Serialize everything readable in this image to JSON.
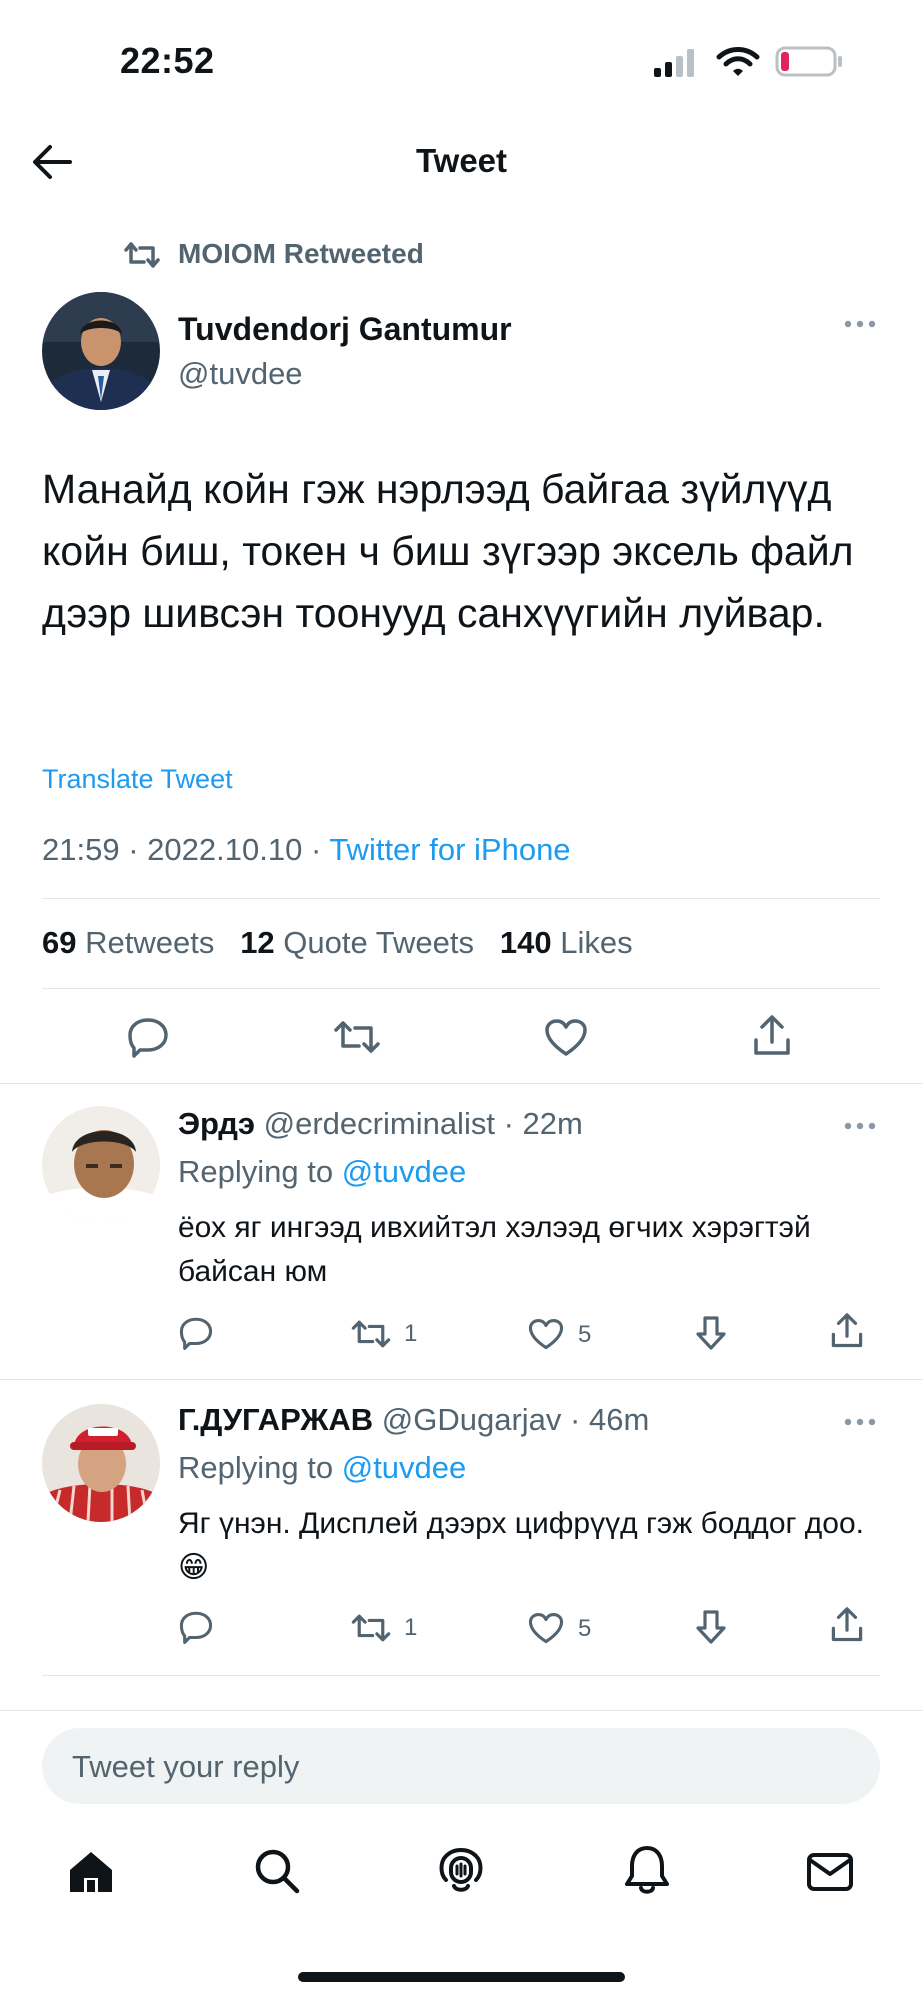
{
  "status_bar": {
    "time": "22:52"
  },
  "header": {
    "title": "Tweet"
  },
  "retweet": {
    "label": "MOIOM Retweeted"
  },
  "tweet": {
    "author_name": "Tuvdendorj Gantumur",
    "author_handle": "@tuvdee",
    "text": "Манайд койн гэж нэрлээд байгаа зүйлүүд койн биш, токен ч биш зүгээр эксель файл дээр шивсэн тоонууд санхүүгийн луйвар.",
    "translate_label": "Translate Tweet",
    "time": "21:59",
    "date": "2022.10.10",
    "source": "Twitter for iPhone",
    "separator": "·",
    "retweets_count": "69",
    "retweets_label": "Retweets",
    "quotes_count": "12",
    "quotes_label": "Quote Tweets",
    "likes_count": "140",
    "likes_label": "Likes"
  },
  "replies": [
    {
      "name": "Эрдэ",
      "handle": "@erdecriminalist",
      "time_ago": "22m",
      "replying_prefix": "Replying to",
      "replying_to": "@tuvdee",
      "text": "ёох яг ингээд ивхийтэл хэлээд өгчих хэрэгтэй байсан юм",
      "retweet_count": "1",
      "like_count": "5"
    },
    {
      "name": "Г.ДУГАРЖАВ",
      "handle": "@GDugarjav",
      "time_ago": "46m",
      "replying_prefix": "Replying to",
      "replying_to": "@tuvdee",
      "text": "Яг үнэн. Дисплей дээрх цифрүүд гэж боддог доо.",
      "emoji": "😁",
      "retweet_count": "1",
      "like_count": "5"
    }
  ],
  "composer": {
    "placeholder": "Tweet your reply"
  },
  "colors": {
    "accent": "#1d9bf0",
    "text_primary": "#0f1419",
    "text_secondary": "#536471",
    "divider": "#e1e6ea",
    "battery_low": "#e0245e"
  },
  "icons": {
    "back": "arrow-left-icon",
    "more": "more-horizontal-icon",
    "reply": "reply-icon",
    "retweet": "retweet-icon",
    "like": "heart-icon",
    "share": "share-icon",
    "downvote": "downvote-icon",
    "home": "home-icon",
    "search": "search-icon",
    "spaces": "spaces-icon",
    "notifications": "bell-icon",
    "messages": "mail-icon"
  }
}
